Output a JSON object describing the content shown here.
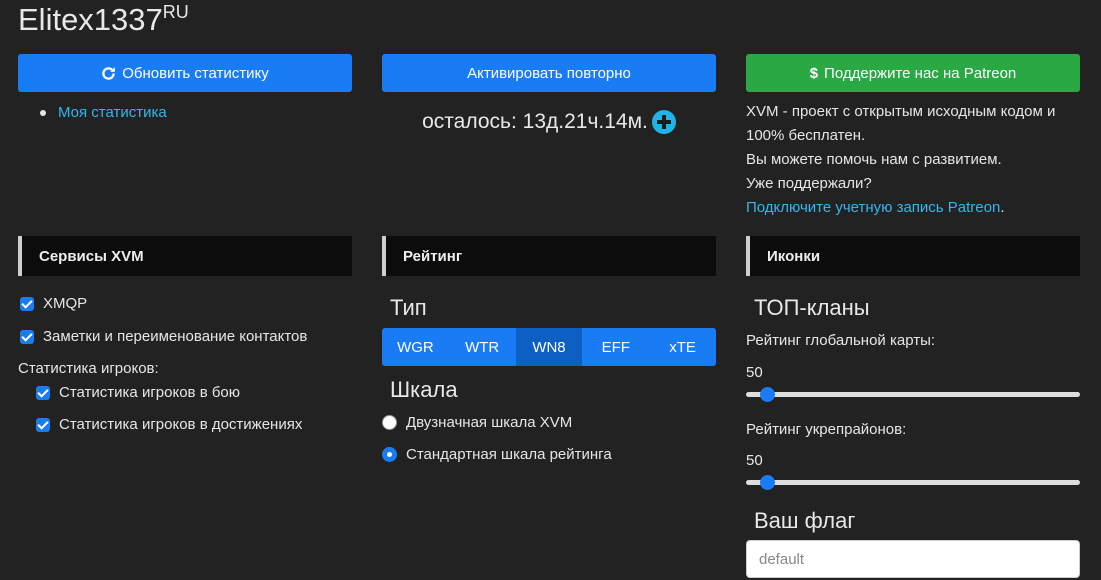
{
  "header": {
    "username": "Elitex1337",
    "region": "RU"
  },
  "actions": {
    "refresh_label": "Обновить статистику",
    "reactivate_label": "Активировать повторно",
    "patreon_label": "Поддержите нас на Patreon"
  },
  "my_stats_link": "Моя статистика",
  "remaining": "осталось: 13д.21ч.14м.",
  "patreon": {
    "line1": "XVM - проект с открытым исходным кодом и 100% бесплатен.",
    "line2": "Вы можете помочь нам с развитием.",
    "line3": "Уже поддержали?",
    "link": "Подключите учетную запись Patreon",
    "link_suffix": "."
  },
  "services": {
    "title": "Сервисы XVM",
    "xmqp": "XMQP",
    "contacts": "Заметки и переименование контактов",
    "player_stats_heading": "Статистика игроков:",
    "in_battle": "Статистика игроков в бою",
    "in_achievements": "Статистика игроков в достижениях"
  },
  "rating": {
    "title": "Рейтинг",
    "type_heading": "Тип",
    "types": [
      "WGR",
      "WTR",
      "WN8",
      "EFF",
      "xTE"
    ],
    "active_type": "WN8",
    "scale_heading": "Шкала",
    "scale_xvm": "Двузначная шкала XVM",
    "scale_standard": "Стандартная шкала рейтинга",
    "selected_scale": "standard"
  },
  "icons": {
    "title": "Иконки",
    "top_clans": "ТОП-кланы",
    "global_map_label": "Рейтинг глобальной карты:",
    "global_map_value": "50",
    "strongholds_label": "Рейтинг укрепрайонов:",
    "strongholds_value": "50",
    "flag_heading": "Ваш флаг",
    "flag_placeholder": "default"
  },
  "colors": {
    "primary": "#1a7cf4",
    "success": "#29a844",
    "link": "#34b6ef",
    "background": "#222222"
  }
}
